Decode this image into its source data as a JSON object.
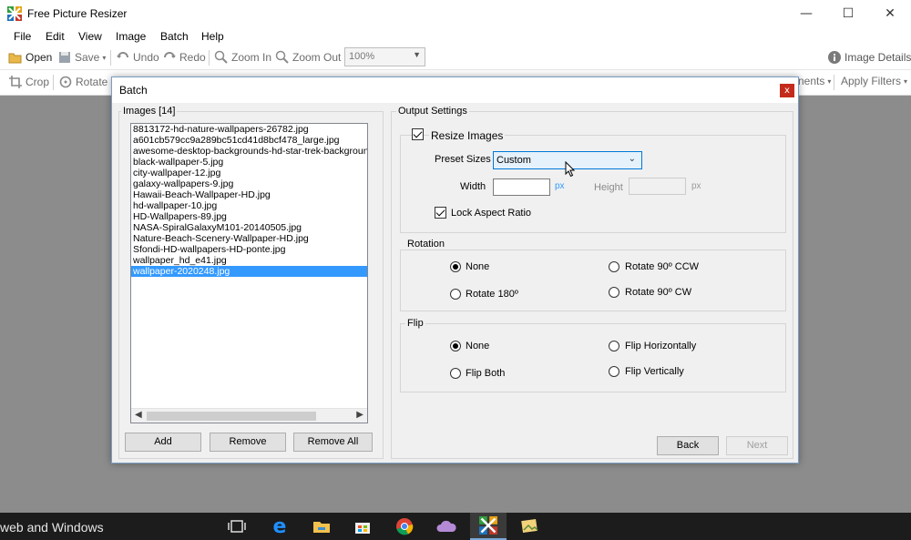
{
  "app": {
    "title": "Free Picture Resizer",
    "window_controls": {
      "minimize": "—",
      "maximize": "☐",
      "close": "✕"
    }
  },
  "menu": [
    "File",
    "Edit",
    "View",
    "Image",
    "Batch",
    "Help"
  ],
  "toolbar": {
    "open": "Open",
    "save": "Save",
    "undo": "Undo",
    "redo": "Redo",
    "zoom_in": "Zoom In",
    "zoom_out": "Zoom Out",
    "zoom_value": "100%",
    "image_details": "Image Details"
  },
  "toolbar2": {
    "crop": "Crop",
    "rotate": "Rotate 9",
    "adjustments": "nents",
    "apply_filters": "Apply Filters"
  },
  "dialog": {
    "title": "Batch",
    "close": "x",
    "images_group": "Images [14]",
    "images": [
      "8813172-hd-nature-wallpapers-26782.jpg",
      "a601cb579cc9a289bc51cd41d8bcf478_large.jpg",
      "awesome-desktop-backgrounds-hd-star-trek-background-H",
      "black-wallpaper-5.jpg",
      "city-wallpaper-12.jpg",
      "galaxy-wallpapers-9.jpg",
      "Hawaii-Beach-Wallpaper-HD.jpg",
      "hd-wallpaper-10.jpg",
      "HD-Wallpapers-89.jpg",
      "NASA-SpiralGalaxyM101-20140505.jpg",
      "Nature-Beach-Scenery-Wallpaper-HD.jpg",
      "Sfondi-HD-wallpapers-HD-ponte.jpg",
      "wallpaper_hd_e41.jpg",
      "wallpaper-2020248.jpg"
    ],
    "selected_index": 13,
    "buttons": {
      "add": "Add",
      "remove": "Remove",
      "remove_all": "Remove All",
      "back": "Back",
      "next": "Next"
    },
    "output_group": "Output Settings",
    "resize_images": "Resize Images",
    "preset_sizes_label": "Preset Sizes",
    "preset_value": "Custom",
    "width_label": "Width",
    "height_label": "Height",
    "px": "px",
    "lock_aspect": "Lock Aspect Ratio",
    "rotation_group": "Rotation",
    "rotation": {
      "none": "None",
      "r180": "Rotate 180º",
      "ccw": "Rotate 90º CCW",
      "cw": "Rotate 90º CW"
    },
    "flip_group": "Flip",
    "flip": {
      "none": "None",
      "both": "Flip Both",
      "horizontal": "Flip Horizontally",
      "vertical": "Flip Vertically"
    }
  },
  "taskbar": {
    "search_text": "web and Windows"
  }
}
